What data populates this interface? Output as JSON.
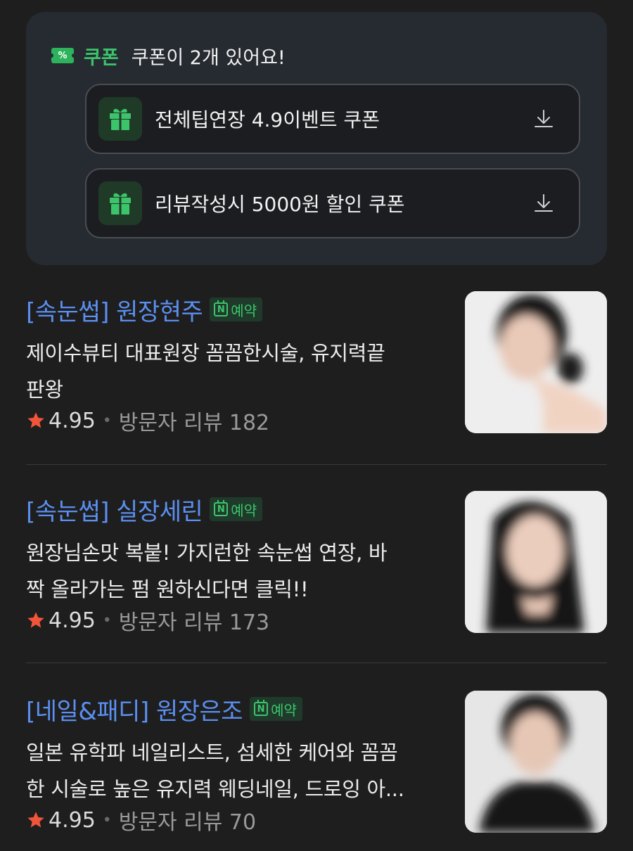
{
  "coupons": {
    "label": "쿠폰",
    "count_text": "쿠폰이 2개 있어요!",
    "items": [
      {
        "name": "전체팁연장 4.9이벤트 쿠폰",
        "icon": "gift-icon",
        "action_icon": "download-icon"
      },
      {
        "name": "리뷰작성시 5000원 할인 쿠폰",
        "icon": "gift-icon",
        "action_icon": "download-icon"
      }
    ]
  },
  "listings": [
    {
      "title": "[속눈썹] 원장현주",
      "badge": "예약",
      "desc_line1": "제이수뷰티 대표원장 꼼꼼한시술, 유지력끝",
      "desc_line2": "판왕",
      "rating": "4.95",
      "review": "방문자 리뷰 182"
    },
    {
      "title": "[속눈썹] 실장세린",
      "badge": "예약",
      "desc_line1": "원장님손맛 복붙! 가지런한 속눈썹 연장, 바",
      "desc_line2": "짝 올라가는 펌 원하신다면 클릭!!",
      "rating": "4.95",
      "review": "방문자 리뷰 173"
    },
    {
      "title": "[네일&패디] 원장은조",
      "badge": "예약",
      "desc_line1": "일본 유학파 네일리스트, 섬세한 케어와 꼼꼼",
      "desc_line2": "한 시술로 높은 유지력 웨딩네일, 드로잉 아...",
      "rating": "4.95",
      "review": "방문자 리뷰 70"
    }
  ],
  "colors": {
    "background": "#1e1e1e",
    "panel": "#262a31",
    "accent_green": "#3cc46b",
    "title_blue": "#5b8ff0",
    "star": "#f0553a"
  }
}
